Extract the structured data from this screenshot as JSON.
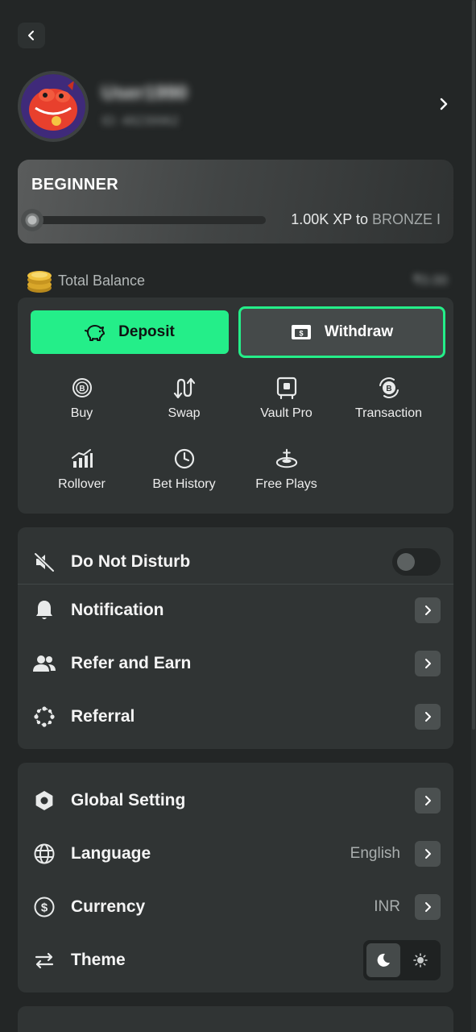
{
  "profile": {
    "username": "User1990",
    "user_id": "ID: 48239962"
  },
  "level": {
    "name": "BEGINNER",
    "progress": 0.0,
    "xp_text": "1.00K XP to",
    "next_tier": "BRONZE I"
  },
  "balance": {
    "label": "Total Balance",
    "value": "₹0.00"
  },
  "wallet": {
    "deposit_label": "Deposit",
    "withdraw_label": "Withdraw",
    "actions": [
      {
        "label": "Buy",
        "icon": "bitcoin-coin-icon"
      },
      {
        "label": "Swap",
        "icon": "swap-arrows-icon"
      },
      {
        "label": "Vault Pro",
        "icon": "vault-icon"
      },
      {
        "label": "Transaction",
        "icon": "transaction-icon"
      },
      {
        "label": "Rollover",
        "icon": "rollover-chart-icon"
      },
      {
        "label": "Bet History",
        "icon": "clock-icon"
      },
      {
        "label": "Free Plays",
        "icon": "joystick-icon"
      }
    ]
  },
  "settings_1": {
    "do_not_disturb": {
      "label": "Do Not Disturb",
      "enabled": false
    },
    "notification": {
      "label": "Notification"
    },
    "refer_and_earn": {
      "label": "Refer and Earn"
    },
    "referral": {
      "label": "Referral"
    }
  },
  "settings_2": {
    "global_setting": {
      "label": "Global Setting"
    },
    "language": {
      "label": "Language",
      "value": "English"
    },
    "currency": {
      "label": "Currency",
      "value": "INR"
    },
    "theme": {
      "label": "Theme",
      "selected": "dark"
    }
  },
  "colors": {
    "accent": "#24ee89",
    "background": "#232626",
    "panel": "#303434"
  }
}
